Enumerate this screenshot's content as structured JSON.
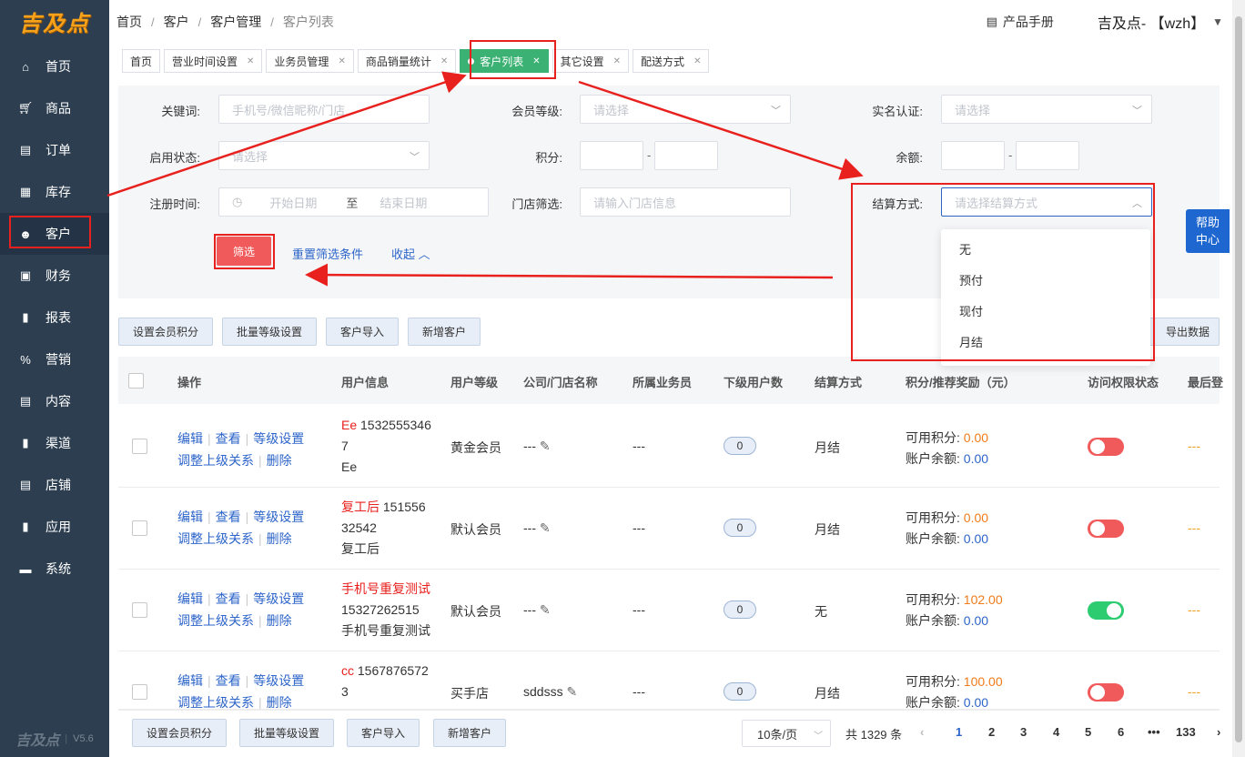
{
  "app": {
    "logo_text": "吉及点",
    "version": "V5.6"
  },
  "sidebar": {
    "items": [
      {
        "label": "首页",
        "icon": "home-icon"
      },
      {
        "label": "商品",
        "icon": "cart-icon"
      },
      {
        "label": "订单",
        "icon": "order-icon"
      },
      {
        "label": "库存",
        "icon": "grid-icon"
      },
      {
        "label": "客户",
        "icon": "user-icon"
      },
      {
        "label": "财务",
        "icon": "finance-icon"
      },
      {
        "label": "报表",
        "icon": "chart-icon"
      },
      {
        "label": "营销",
        "icon": "percent-icon"
      },
      {
        "label": "内容",
        "icon": "doc-icon"
      },
      {
        "label": "渠道",
        "icon": "chart-icon"
      },
      {
        "label": "店铺",
        "icon": "doc-icon"
      },
      {
        "label": "应用",
        "icon": "chart-icon"
      },
      {
        "label": "系统",
        "icon": "monitor-icon"
      }
    ],
    "active_index": 4
  },
  "header": {
    "breadcrumb": [
      "首页",
      "客户",
      "客户管理",
      "客户列表"
    ],
    "manual": "产品手册",
    "user": "吉及点- 【wzh】"
  },
  "tabs": [
    {
      "label": "首页",
      "closable": false
    },
    {
      "label": "营业时间设置",
      "closable": true
    },
    {
      "label": "业务员管理",
      "closable": true
    },
    {
      "label": "商品销量统计",
      "closable": true
    },
    {
      "label": "客户列表",
      "closable": true,
      "active": true
    },
    {
      "label": "其它设置",
      "closable": true
    },
    {
      "label": "配送方式",
      "closable": true
    }
  ],
  "filter": {
    "keyword": {
      "label": "关键词:",
      "placeholder": "手机号/微信昵称/门店"
    },
    "level": {
      "label": "会员等级:",
      "placeholder": "请选择"
    },
    "realname": {
      "label": "实名认证:",
      "placeholder": "请选择"
    },
    "status": {
      "label": "启用状态:",
      "placeholder": "请选择"
    },
    "points": {
      "label": "积分:",
      "sep": "-"
    },
    "balance": {
      "label": "余额:",
      "sep": "-"
    },
    "regtime": {
      "label": "注册时间:",
      "start": "开始日期",
      "mid": "至",
      "end": "结束日期"
    },
    "store": {
      "label": "门店筛选:",
      "placeholder": "请输入门店信息"
    },
    "settle": {
      "label": "结算方式:",
      "placeholder": "请选择结算方式"
    },
    "filter_btn": "筛选",
    "reset": "重置筛选条件",
    "collapse": "收起"
  },
  "settle_options": [
    "无",
    "预付",
    "现付",
    "月结"
  ],
  "actions": {
    "points": "设置会员积分",
    "batch_level": "批量等级设置",
    "import": "客户导入",
    "add": "新增客户",
    "export": "导出数据"
  },
  "table": {
    "headers": [
      "操作",
      "用户信息",
      "用户等级",
      "公司/门店名称",
      "所属业务员",
      "下级用户数",
      "结算方式",
      "积分/推荐奖励（元）",
      "访问权限状态",
      "最后登"
    ],
    "op_links": {
      "edit": "编辑",
      "view": "查看",
      "level": "等级设置",
      "adjust": "调整上级关系",
      "delete": "删除"
    },
    "points_label": "可用积分:",
    "balance_label": "账户余额:",
    "rows": [
      {
        "name": "Ee",
        "phone1": "1532555346",
        "phone2": "7",
        "sub": "Ee",
        "level": "黄金会员",
        "company": "---",
        "sales": "---",
        "count": "0",
        "settle": "月结",
        "points": "0.00",
        "balance": "0.00",
        "access": false,
        "last": "---"
      },
      {
        "name": "复工后",
        "phone1": "151556",
        "phone2": "32542",
        "sub": "复工后",
        "level": "默认会员",
        "company": "---",
        "sales": "---",
        "count": "0",
        "settle": "月结",
        "points": "0.00",
        "balance": "0.00",
        "access": false,
        "last": "---"
      },
      {
        "name": "手机号重复测试",
        "phone1": "",
        "phone2": "15327262515",
        "sub": "手机号重复测试",
        "level": "默认会员",
        "company": "---",
        "sales": "---",
        "count": "0",
        "settle": "无",
        "points": "102.00",
        "balance": "0.00",
        "access": true,
        "last": "---"
      },
      {
        "name": "cc",
        "phone1": "1567876572",
        "phone2": "3",
        "sub": "",
        "level": "买手店",
        "company": "sddsss",
        "sales": "---",
        "count": "0",
        "settle": "月结",
        "points": "100.00",
        "balance": "0.00",
        "access": false,
        "last": "---"
      }
    ]
  },
  "pagination": {
    "page_size": "10条/页",
    "total": "共 1329 条",
    "pages": [
      "1",
      "2",
      "3",
      "4",
      "5",
      "6",
      "•••",
      "133"
    ],
    "current": "1"
  },
  "help": {
    "line1": "帮助",
    "line2": "中心"
  },
  "colors": {
    "sidebar": "#2c3e50",
    "accent_green": "#3bb273",
    "annotation_red": "#e8211e",
    "link_blue": "#2d65c9"
  }
}
